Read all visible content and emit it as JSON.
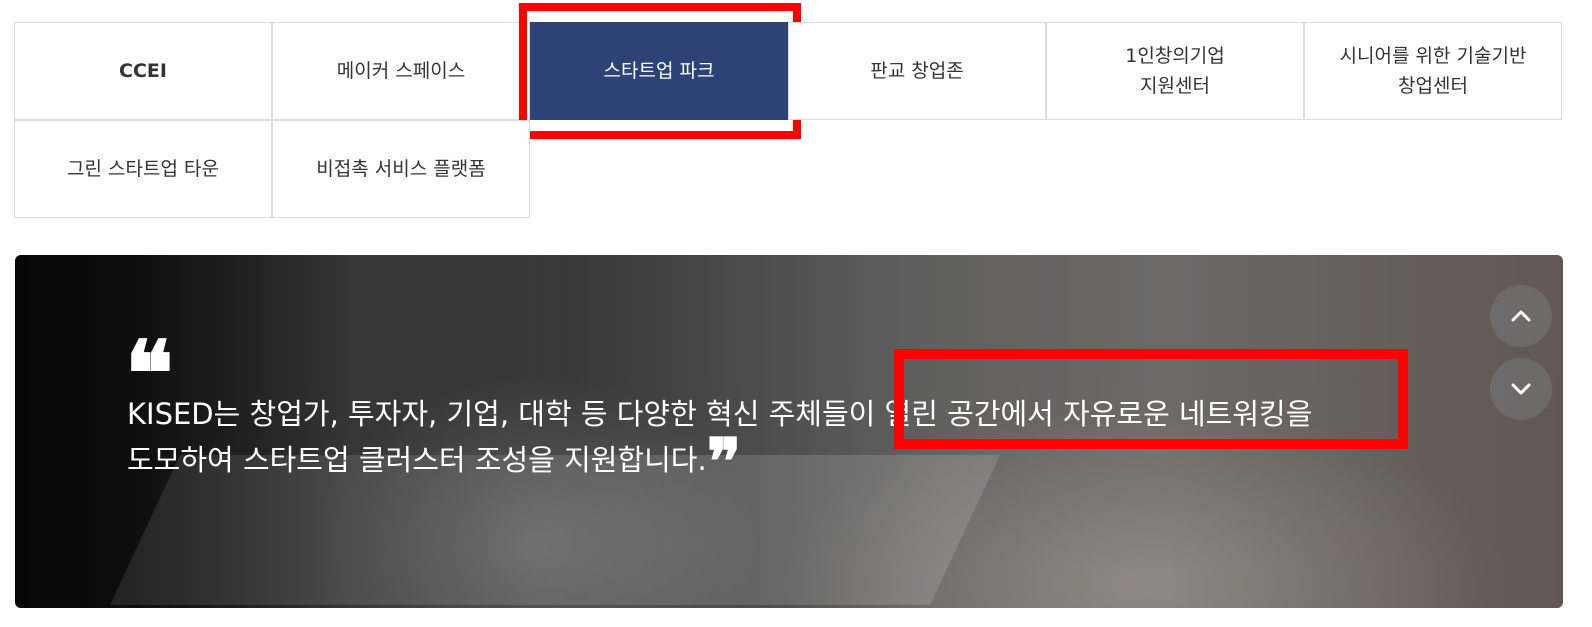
{
  "tabs": [
    {
      "label": "CCEI",
      "bold": true,
      "active": false
    },
    {
      "label": "메이커 스페이스",
      "bold": false,
      "active": false
    },
    {
      "label": "스타트업 파크",
      "bold": false,
      "active": true
    },
    {
      "label": "판교 창업존",
      "bold": false,
      "active": false
    },
    {
      "label": "1인창의기업\n지원센터",
      "bold": false,
      "active": false
    },
    {
      "label": "시니어를 위한 기술기반\n창업센터",
      "bold": false,
      "active": false
    },
    {
      "label": "그린 스타트업 타운",
      "bold": false,
      "active": false
    },
    {
      "label": "비접촉 서비스 플랫폼",
      "bold": false,
      "active": false
    }
  ],
  "banner": {
    "quote_open": "❝",
    "quote_line1": "KISED는 창업가, 투자자, 기업, 대학 등 다양한 혁신 주체들이 열린 공간에서 자유로운 네트워킹을",
    "quote_line2": "도모하여 스타트업 클러스터 조성을 지원합니다.",
    "quote_close": "❞",
    "scroll_up_icon": "chevron-up-icon",
    "scroll_down_icon": "chevron-down-icon"
  },
  "colors": {
    "active_tab": "#2d4377",
    "highlight": "#ff0000"
  }
}
